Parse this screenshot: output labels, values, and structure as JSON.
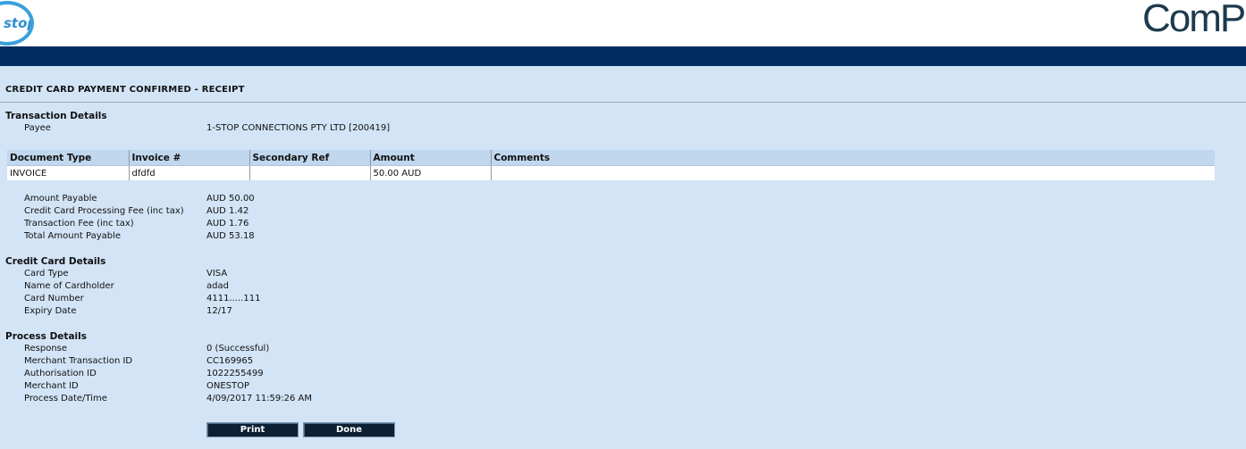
{
  "header": {
    "logo_left_text": "stop",
    "logo_right_text": "ComPa"
  },
  "page": {
    "title": "CREDIT CARD PAYMENT CONFIRMED - RECEIPT"
  },
  "transaction": {
    "title": "Transaction Details",
    "payee_label": "Payee",
    "payee_value": "1-STOP CONNECTIONS PTY LTD [200419]"
  },
  "items_table": {
    "headers": [
      "Document Type",
      "Invoice #",
      "Secondary Ref",
      "Amount",
      "Comments"
    ],
    "rows": [
      [
        "INVOICE",
        "dfdfd",
        "",
        "50.00 AUD",
        ""
      ]
    ]
  },
  "amounts": [
    {
      "label": "Amount Payable",
      "value": "AUD 50.00"
    },
    {
      "label": "Credit Card Processing Fee (inc tax)",
      "value": "AUD 1.42"
    },
    {
      "label": "Transaction Fee (inc tax)",
      "value": "AUD 1.76"
    },
    {
      "label": "Total Amount Payable",
      "value": "AUD 53.18"
    }
  ],
  "card": {
    "title": "Credit Card Details",
    "fields": [
      {
        "label": "Card Type",
        "value": "VISA"
      },
      {
        "label": "Name of Cardholder",
        "value": "adad"
      },
      {
        "label": "Card Number",
        "value": "4111.....111"
      },
      {
        "label": "Expiry Date",
        "value": "12/17"
      }
    ]
  },
  "process": {
    "title": "Process Details",
    "fields": [
      {
        "label": "Response",
        "value": "0 (Successful)"
      },
      {
        "label": "Merchant Transaction ID",
        "value": "CC169965"
      },
      {
        "label": "Authorisation ID",
        "value": "1022255499"
      },
      {
        "label": "Merchant ID",
        "value": "ONESTOP"
      },
      {
        "label": "Process Date/Time",
        "value": "4/09/2017 11:59:26 AM"
      }
    ]
  },
  "buttons": {
    "print_label": "Print",
    "done_label": "Done"
  },
  "colors": {
    "navbar": "#002d62",
    "background": "#d2e4f6",
    "table_header": "#c1d7ee",
    "button": "#0c1f33"
  }
}
